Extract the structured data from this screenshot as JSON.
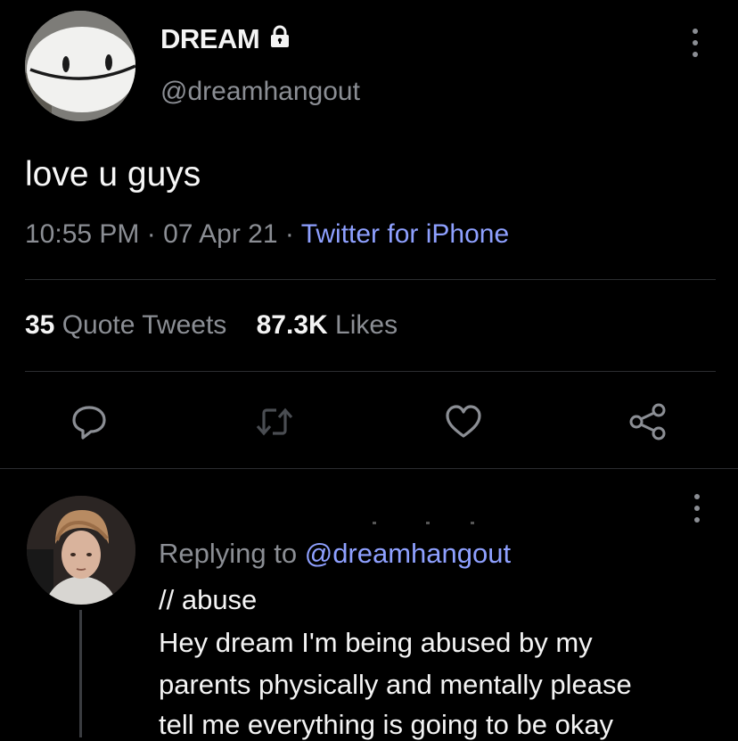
{
  "tweet": {
    "display_name": "DREAM",
    "handle": "@dreamhangout",
    "text": "love u guys",
    "time": "10:55 PM",
    "date": "07 Apr 21",
    "separator": "·",
    "client": "Twitter for iPhone",
    "quote_count": "35",
    "quote_label": "Quote Tweets",
    "like_count": "87.3K",
    "like_label": "Likes",
    "icons": {
      "lock": "lock-icon",
      "more": "more-vertical-icon",
      "reply": "reply-icon",
      "retweet": "retweet-icon",
      "like": "heart-icon",
      "share": "share-icon"
    }
  },
  "reply": {
    "replying_prefix": "Replying to",
    "replying_to": "@dreamhangout",
    "content_warning": "// abuse",
    "lines": [
      "Hey dream I'm being abused by my",
      "parents physically and mentally please",
      "tell me everything is going to be okay"
    ]
  },
  "colors": {
    "background": "#000000",
    "text": "#f4f4f4",
    "muted": "#8b8e94",
    "link": "#8ea0ff",
    "divider": "#2b2d30"
  }
}
